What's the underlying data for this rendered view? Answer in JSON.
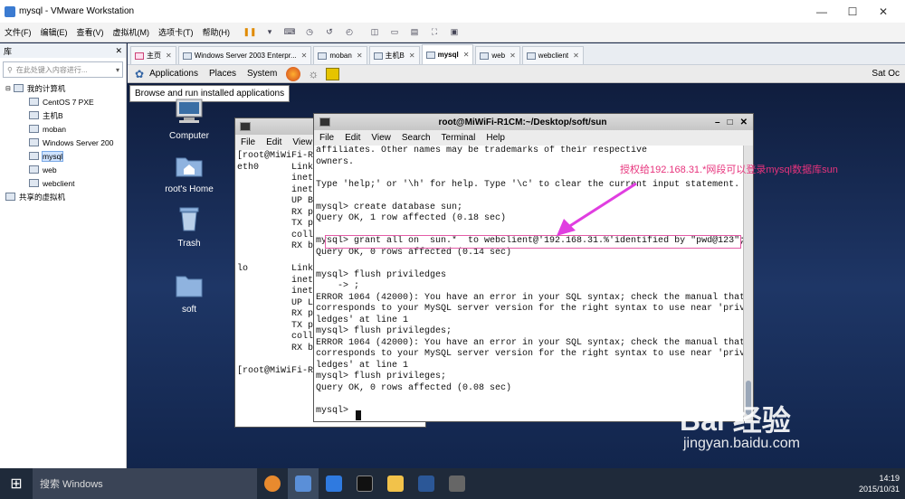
{
  "window": {
    "title": "mysql - VMware Workstation"
  },
  "menu": [
    "文件(F)",
    "编辑(E)",
    "查看(V)",
    "虚拟机(M)",
    "选项卡(T)",
    "帮助(H)"
  ],
  "library": {
    "title": "库",
    "search_placeholder": "在此处键入内容进行...",
    "root": "我的计算机",
    "vms": [
      "CentOS 7 PXE",
      "主机B",
      "moban",
      "Windows Server 200",
      "mysql",
      "web",
      "webclient"
    ],
    "shared": "共享的虚拟机"
  },
  "tabs": [
    {
      "label": "主页"
    },
    {
      "label": "Windows Server 2003 Enterpr..."
    },
    {
      "label": "moban"
    },
    {
      "label": "主机B"
    },
    {
      "label": "mysql",
      "active": true
    },
    {
      "label": "web"
    },
    {
      "label": "webclient"
    }
  ],
  "guest": {
    "menu": [
      "Applications",
      "Places",
      "System"
    ],
    "clock": "Sat Oc",
    "tooltip": "Browse and run installed applications",
    "desktop_icons": [
      "Computer",
      "root's Home",
      "Trash",
      "soft"
    ]
  },
  "terminal1": {
    "menu": [
      "File",
      "Edit",
      "View"
    ],
    "text": "[root@MiWiFi-R1\neth0      Link\n          inet\n          inet6\n          UP BR\n          RX pa\n          TX pa\n          colli\n          RX by\n\nlo        Link\n          inet\n          inet6\n          UP LO\n          RX pa\n          TX pa\n          colli\n          RX by\n\n[root@MiWiFi-R1"
  },
  "terminal2": {
    "title": "root@MiWiFi-R1CM:~/Desktop/soft/sun",
    "menu": [
      "File",
      "Edit",
      "View",
      "Search",
      "Terminal",
      "Help"
    ],
    "lines": [
      "affiliates. Other names may be trademarks of their respective",
      "owners.",
      "",
      "Type 'help;' or '\\h' for help. Type '\\c' to clear the current input statement.",
      "",
      "mysql> create database sun;",
      "Query OK, 1 row affected (0.18 sec)",
      "",
      "mysql> grant all on  sun.*  to webclient@'192.168.31.%'identified by \"pwd@123\";",
      "Query OK, 0 rows affected (0.14 sec)",
      "",
      "mysql> flush priviledges",
      "    -> ;",
      "ERROR 1064 (42000): You have an error in your SQL syntax; check the manual that",
      "corresponds to your MySQL server version for the right syntax to use near 'privi",
      "ledges' at line 1",
      "mysql> flush privilegdes;",
      "ERROR 1064 (42000): You have an error in your SQL syntax; check the manual that",
      "corresponds to your MySQL server version for the right syntax to use near 'privi",
      "ledges' at line 1",
      "mysql> flush privileges;",
      "Query OK, 0 rows affected (0.08 sec)",
      "",
      "mysql> "
    ]
  },
  "annotation": "授权给192.168.31.*网段可以登录mysql数据库sun",
  "taskbar": {
    "search_placeholder": "搜索 Windows",
    "time": "14:19",
    "date": "2015/10/31"
  },
  "watermark": {
    "brand": "Bai 经验",
    "url": "jingyan.baidu.com"
  }
}
